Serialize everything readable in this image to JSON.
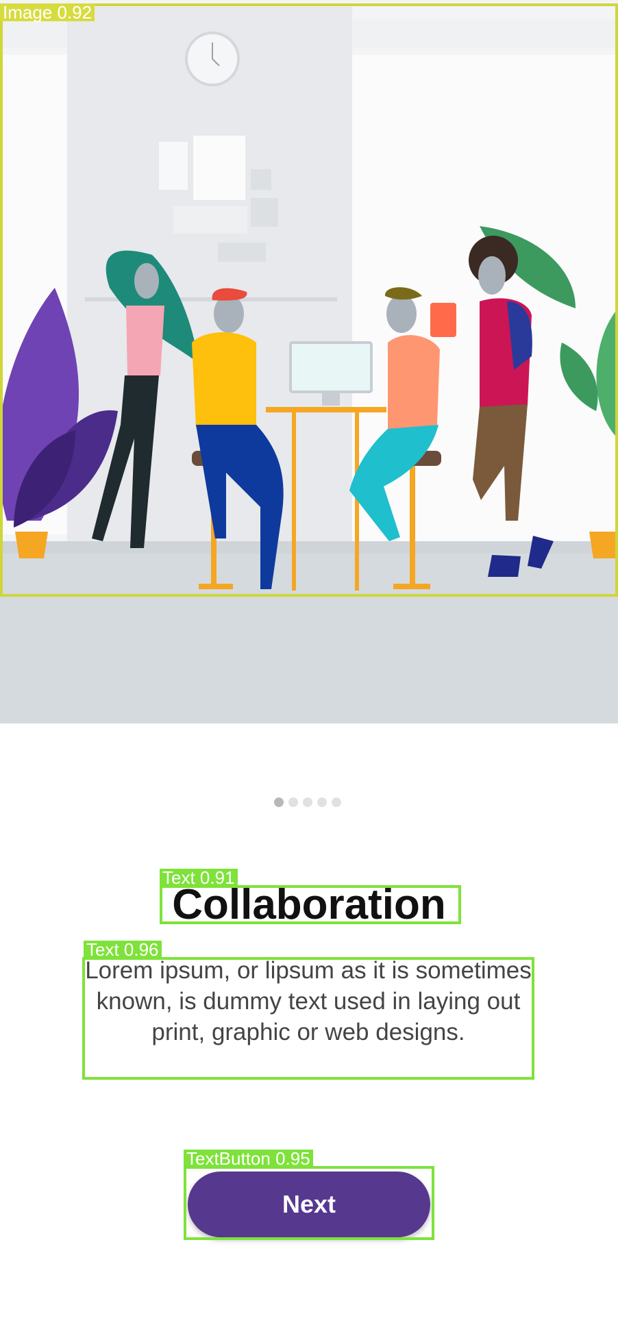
{
  "onboarding": {
    "title": "Collaboration",
    "description": "Lorem ipsum, or lipsum as it is sometimes known, is dummy text used in laying out print, graphic or web designs.",
    "next_label": "Next",
    "page_count": 5,
    "active_page": 1
  },
  "detections": {
    "image": "Image 0.92",
    "title_text": "Text 0.91",
    "description_text": "Text 0.96",
    "next_button": "TextButton 0.95"
  },
  "colors": {
    "accent": "#57388f",
    "detection_image": "#cfd63a",
    "detection_green": "#7ee23a"
  }
}
